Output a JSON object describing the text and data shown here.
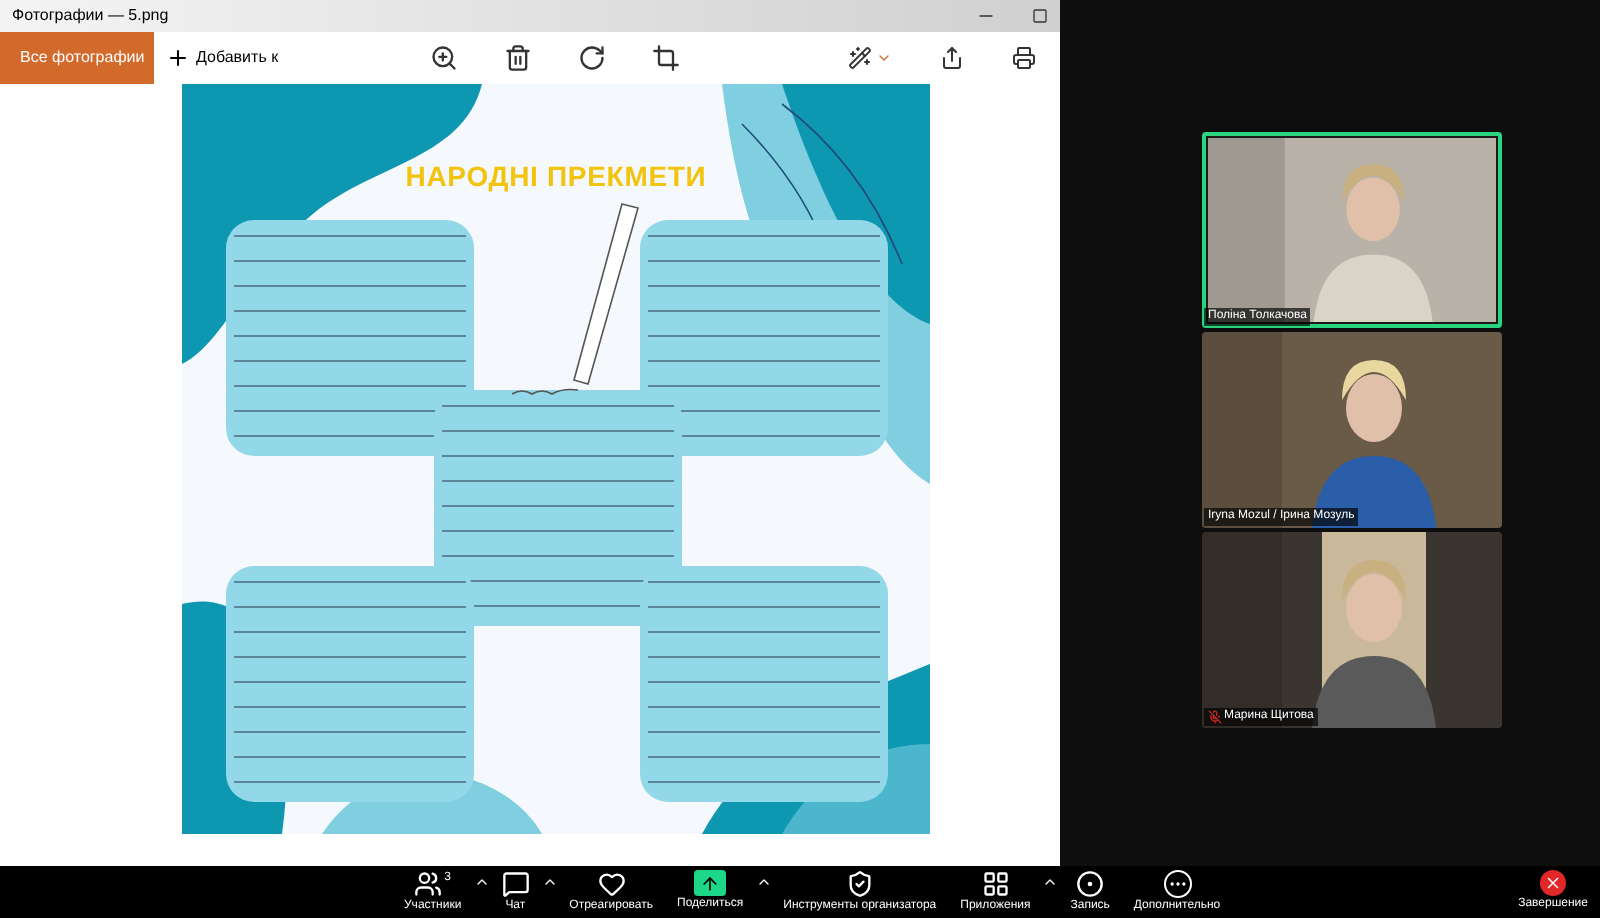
{
  "photos_window": {
    "title": "Фотографии — 5.png",
    "all_photos_button": "Все фотографии",
    "add_button": "Добавить к"
  },
  "poster": {
    "title": "НАРОДНІ ПРЕКМЕТИ"
  },
  "participants": [
    {
      "name": "Поліна Толкачова",
      "muted": false,
      "active": true
    },
    {
      "name": "Iryna Mozul / Ірина Мозуль",
      "muted": false,
      "active": false
    },
    {
      "name": "Марина Щитова",
      "muted": true,
      "active": false
    }
  ],
  "meeting_toolbar": [
    {
      "kind": "participants",
      "label": "Участники",
      "count": "3",
      "menu": true
    },
    {
      "kind": "chat",
      "label": "Чат",
      "menu": true
    },
    {
      "kind": "react",
      "label": "Отреагировать",
      "menu": false
    },
    {
      "kind": "share",
      "label": "Поделиться",
      "menu": true
    },
    {
      "kind": "host",
      "label": "Инструменты организатора",
      "menu": false
    },
    {
      "kind": "apps",
      "label": "Приложения",
      "menu": true
    },
    {
      "kind": "record",
      "label": "Запись",
      "menu": false
    },
    {
      "kind": "more",
      "label": "Дополнительно",
      "menu": false
    }
  ],
  "end_button": "Завершение"
}
